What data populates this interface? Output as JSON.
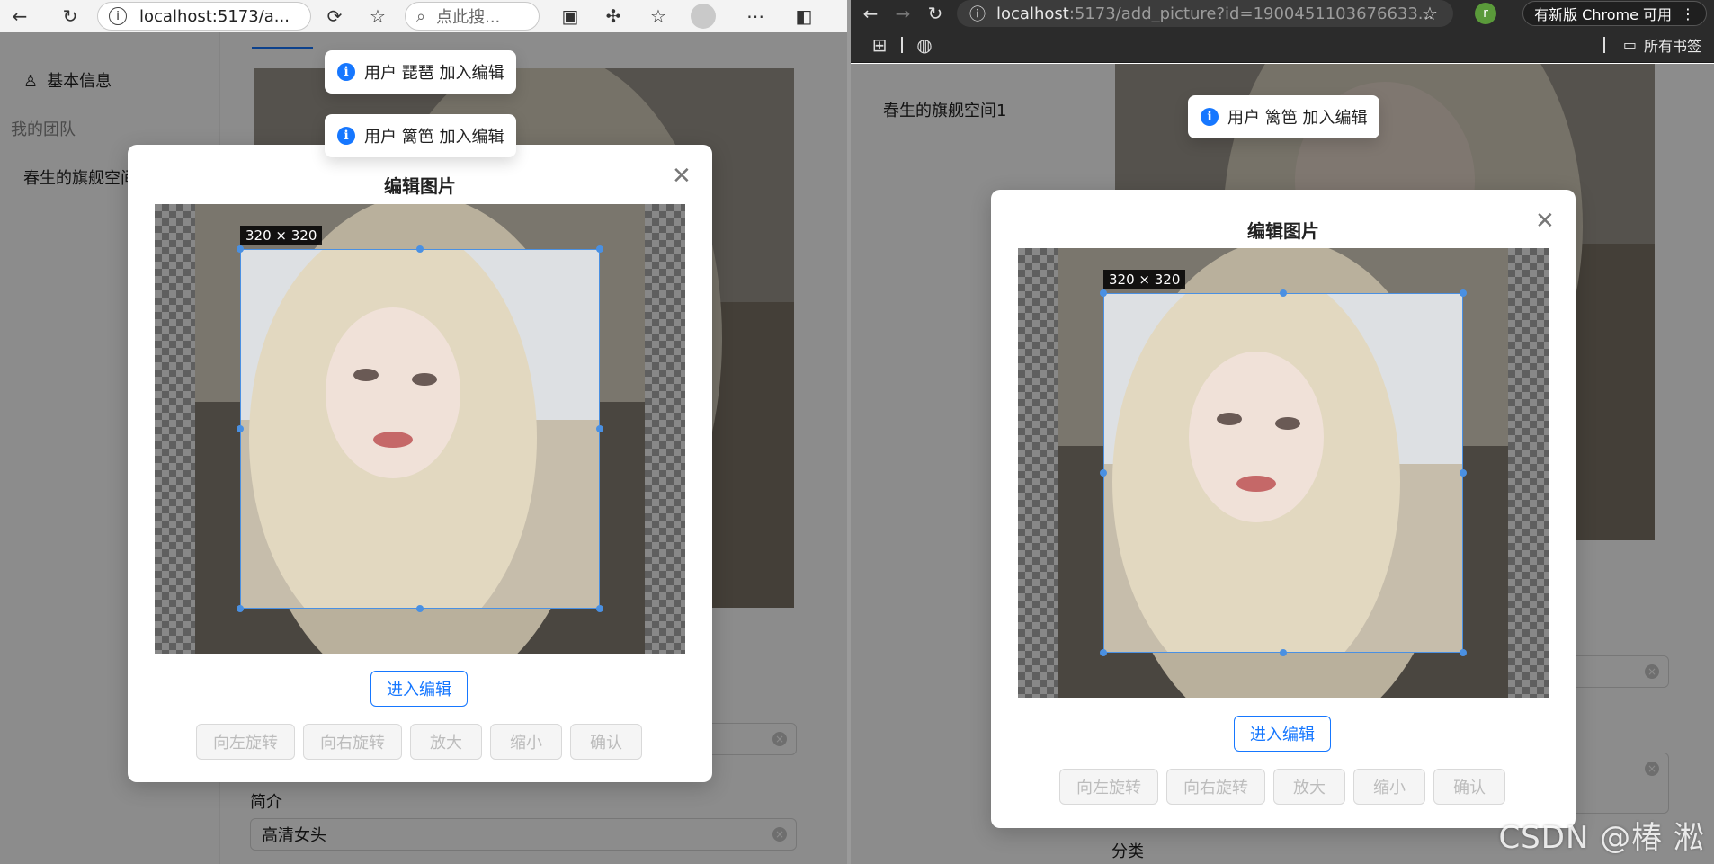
{
  "left_browser": {
    "url": "localhost:5173/a...",
    "search_placeholder": "点此搜...",
    "sidebar": {
      "item_basic": "基本信息",
      "group_my_team": "我的团队",
      "item_space": "春生的旗舰空间"
    },
    "form": {
      "intro_label": "简介",
      "intro_value": "高清女头"
    },
    "toasts": [
      "用户 琵琶 加入编辑",
      "用户 篱笆 加入编辑"
    ],
    "modal": {
      "title": "编辑图片",
      "crop_size": "320 × 320",
      "enter_edit": "进入编辑",
      "buttons": [
        "向左旋转",
        "向右旋转",
        "放大",
        "缩小",
        "确认"
      ]
    }
  },
  "right_browser": {
    "url_host": "localhost",
    "url_rest": ":5173/add_picture?id=1900451103676633...",
    "update_badge": "有新版 Chrome 可用",
    "profile_initial": "r",
    "bookmarks_label": "所有书签",
    "sidebar": {
      "item_space": "春生的旗舰空间1"
    },
    "form": {
      "category_label": "分类"
    },
    "toasts": [
      "用户 篱笆 加入编辑"
    ],
    "modal": {
      "title": "编辑图片",
      "crop_size": "320 × 320",
      "enter_edit": "进入编辑",
      "buttons": [
        "向左旋转",
        "向右旋转",
        "放大",
        "缩小",
        "确认"
      ]
    }
  },
  "watermark": "CSDN @椿 淞",
  "colors": {
    "accent": "#1677ff",
    "crop_border": "#4a90e2",
    "mask": "rgba(0,0,0,0.45)"
  }
}
